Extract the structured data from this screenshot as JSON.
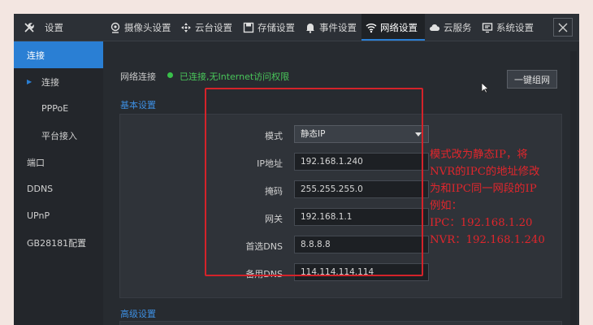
{
  "topbar": {
    "settings_title": "设置",
    "tabs": [
      {
        "label": "摄像头设置",
        "icon": "camera-icon"
      },
      {
        "label": "云台设置",
        "icon": "ptz-icon"
      },
      {
        "label": "存储设置",
        "icon": "storage-icon"
      },
      {
        "label": "事件设置",
        "icon": "bell-icon"
      },
      {
        "label": "网络设置",
        "icon": "wifi-icon",
        "active": true
      },
      {
        "label": "云服务",
        "icon": "cloud-icon"
      },
      {
        "label": "系统设置",
        "icon": "monitor-icon"
      }
    ]
  },
  "sidebar": {
    "items": [
      {
        "label": "连接",
        "active": true
      },
      {
        "label": "连接"
      },
      {
        "label": "PPPoE"
      },
      {
        "label": "平台接入"
      },
      {
        "label": "端口"
      },
      {
        "label": "DDNS"
      },
      {
        "label": "UPnP"
      },
      {
        "label": "GB28181配置"
      }
    ]
  },
  "status": {
    "label": "网络连接",
    "text": "已连接,无Internet访问权限",
    "color": "#49c65a"
  },
  "wizard_button": "一键组网",
  "sections": {
    "basic": "基本设置",
    "advanced": "高级设置"
  },
  "form": {
    "mode_label": "模式",
    "mode_value": "静态IP",
    "ip_label": "IP地址",
    "ip_value": "192.168.1.240",
    "mask_label": "掩码",
    "mask_value": "255.255.255.0",
    "gateway_label": "网关",
    "gateway_value": "192.168.1.1",
    "dns1_label": "首选DNS",
    "dns1_value": "8.8.8.8",
    "dns2_label": "备用DNS",
    "dns2_value": "114.114.114.114"
  },
  "annotation": {
    "lines": [
      "模式改为静态IP，将",
      "NVR的IPC的地址修改",
      "为和IPC同一网段的IP",
      "例如：",
      "IPC：192.168.1.20",
      "NVR：192.168.1.240"
    ],
    "color": "#e0262c"
  },
  "colors": {
    "accent": "#2a7fd4",
    "background": "#262a2f"
  }
}
